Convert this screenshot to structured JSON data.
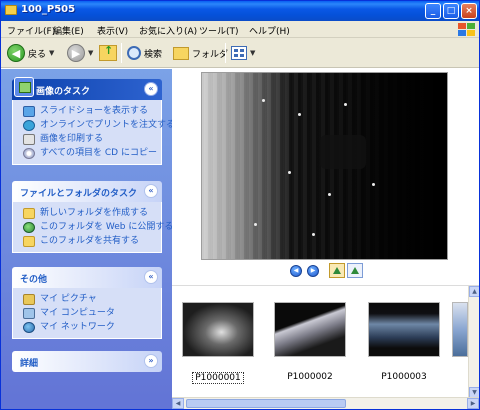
{
  "window": {
    "title": "100_P505"
  },
  "menu": [
    {
      "label": "ファイル(F)"
    },
    {
      "label": "編集(E)"
    },
    {
      "label": "表示(V)"
    },
    {
      "label": "お気に入り(A)"
    },
    {
      "label": "ツール(T)"
    },
    {
      "label": "ヘルプ(H)"
    }
  ],
  "toolbar": {
    "back_label": "戻る",
    "search_label": "検索",
    "folders_label": "フォルダ"
  },
  "taskpane": {
    "image_tasks": {
      "title": "画像のタスク",
      "items": [
        {
          "label": "スライドショーを表示する",
          "icon": "slideshow-icon"
        },
        {
          "label": "オンラインでプリントを注文する",
          "icon": "online-print-icon"
        },
        {
          "label": "画像を印刷する",
          "icon": "printer-icon"
        },
        {
          "label": "すべての項目を CD にコピー",
          "icon": "cd-icon"
        }
      ]
    },
    "file_tasks": {
      "title": "ファイルとフォルダのタスク",
      "items": [
        {
          "label": "新しいフォルダを作成する",
          "icon": "new-folder-icon"
        },
        {
          "label": "このフォルダを Web に公開する",
          "icon": "web-publish-icon"
        },
        {
          "label": "このフォルダを共有する",
          "icon": "share-folder-icon"
        }
      ]
    },
    "other_places": {
      "title": "その他",
      "items": [
        {
          "label": "マイ ピクチャ",
          "icon": "my-pictures-icon"
        },
        {
          "label": "マイ コンピュータ",
          "icon": "my-computer-icon"
        },
        {
          "label": "マイ ネットワーク",
          "icon": "my-network-icon"
        }
      ]
    },
    "details": {
      "title": "詳細"
    }
  },
  "filmstrip": {
    "items": [
      {
        "label": "P1000001",
        "selected": true
      },
      {
        "label": "P1000002",
        "selected": false
      },
      {
        "label": "P1000003",
        "selected": false
      },
      {
        "label": "",
        "selected": false
      }
    ]
  },
  "colors": {
    "title_bar": "#0a58e6",
    "task_pane_top": "#7ba2e7",
    "task_pane_bottom": "#6375d6",
    "link_text": "#215dc6"
  }
}
